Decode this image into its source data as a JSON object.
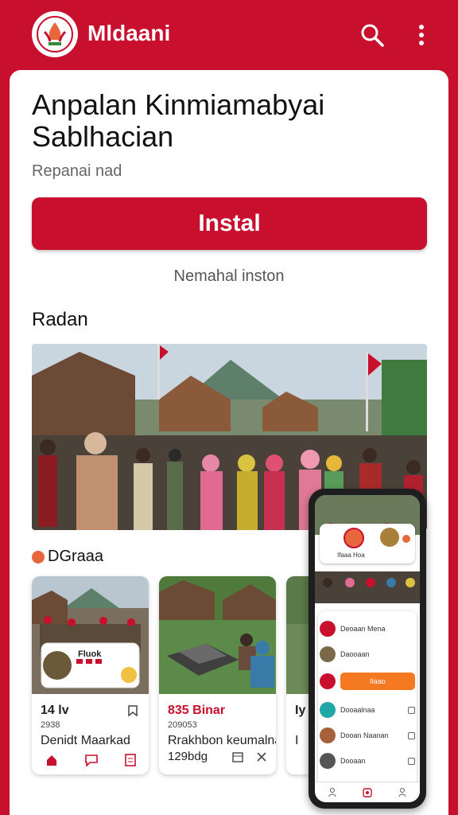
{
  "header": {
    "brand": "Mldaani",
    "logo_icon": "flame-leaf-emblem",
    "actions": [
      "search-icon",
      "more-vert-icon"
    ]
  },
  "app": {
    "title": "Anpalan Kinmiamabyai Sablhacian",
    "subtitle": "Repanai nad",
    "install_label": "Instal",
    "install_note": "Nemahal inston"
  },
  "section": {
    "title": "Radan"
  },
  "gallery": {
    "label": "DGraaa",
    "cards": [
      {
        "line1": "14 lv",
        "line2": "2938",
        "line3": "Denidt Maarkad",
        "badge": "Fluok"
      },
      {
        "line1": "835 Binar",
        "line2": "209053",
        "line3": "Rrakhbon keumalnad",
        "line4": "129bdg"
      },
      {
        "line1": "Iy",
        "line2": "",
        "line3": "I"
      }
    ]
  },
  "phone": {
    "header_label": "Ifaaa Hoa",
    "button_label": "Ilaao",
    "rows": [
      "Deoaan Mena",
      "Daooaan",
      "Dooaalnaa",
      "Dooan Naanan",
      "Dooaan"
    ]
  },
  "colors": {
    "accent": "#c8102e",
    "orange": "#f47920",
    "teal": "#22a7a7"
  }
}
